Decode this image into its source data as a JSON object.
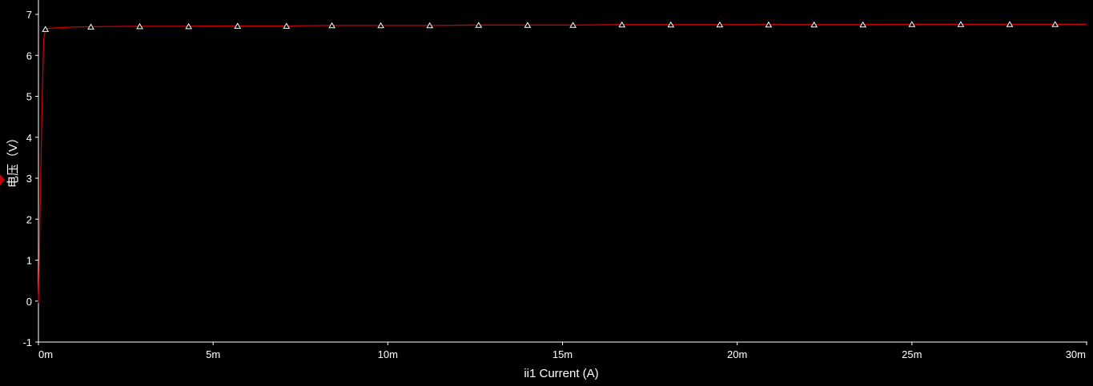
{
  "chart_data": {
    "type": "line",
    "title": "",
    "xlabel": "ii1 Current (A)",
    "ylabel": "电压（V）",
    "xlim": [
      0,
      0.03
    ],
    "ylim": [
      -1,
      7
    ],
    "x_ticks": [
      0,
      0.005,
      0.01,
      0.015,
      0.02,
      0.025,
      0.03
    ],
    "x_tick_labels": [
      "0m",
      "5m",
      "10m",
      "15m",
      "20m",
      "25m",
      "30m"
    ],
    "y_ticks": [
      -1,
      0,
      1,
      2,
      3,
      4,
      5,
      6,
      7
    ],
    "y_tick_labels": [
      "-1",
      "0",
      "1",
      "2",
      "3",
      "4",
      "5",
      "6",
      "7"
    ],
    "grid": false,
    "colors": {
      "background": "#000000",
      "axis": "#ffffff",
      "line": "#cc0000",
      "marker": "#ffffff"
    },
    "series": [
      {
        "marker": "triangle",
        "x": [
          0,
          2e-05,
          5e-05,
          0.0001,
          0.00015,
          0.0002,
          0.0003,
          0.0005,
          0.001,
          0.0015,
          0.0029,
          0.0043,
          0.0057,
          0.0071,
          0.0084,
          0.0098,
          0.0112,
          0.0126,
          0.014,
          0.0153,
          0.0167,
          0.0181,
          0.0195,
          0.0209,
          0.0222,
          0.0236,
          0.025,
          0.0264,
          0.0278,
          0.0291,
          0.03
        ],
        "y": [
          -0.05,
          0.7,
          2.4,
          4.6,
          6.4,
          6.64,
          6.66,
          6.67,
          6.69,
          6.7,
          6.71,
          6.71,
          6.72,
          6.72,
          6.73,
          6.73,
          6.73,
          6.74,
          6.74,
          6.74,
          6.75,
          6.75,
          6.75,
          6.75,
          6.75,
          6.75,
          6.76,
          6.76,
          6.76,
          6.76,
          6.76
        ]
      }
    ],
    "marker_x": [
      0.0002,
      0.0015,
      0.0029,
      0.0043,
      0.0057,
      0.0071,
      0.0084,
      0.0098,
      0.0112,
      0.0126,
      0.014,
      0.0153,
      0.0167,
      0.0181,
      0.0195,
      0.0209,
      0.0222,
      0.0236,
      0.025,
      0.0264,
      0.0278,
      0.0291
    ]
  }
}
